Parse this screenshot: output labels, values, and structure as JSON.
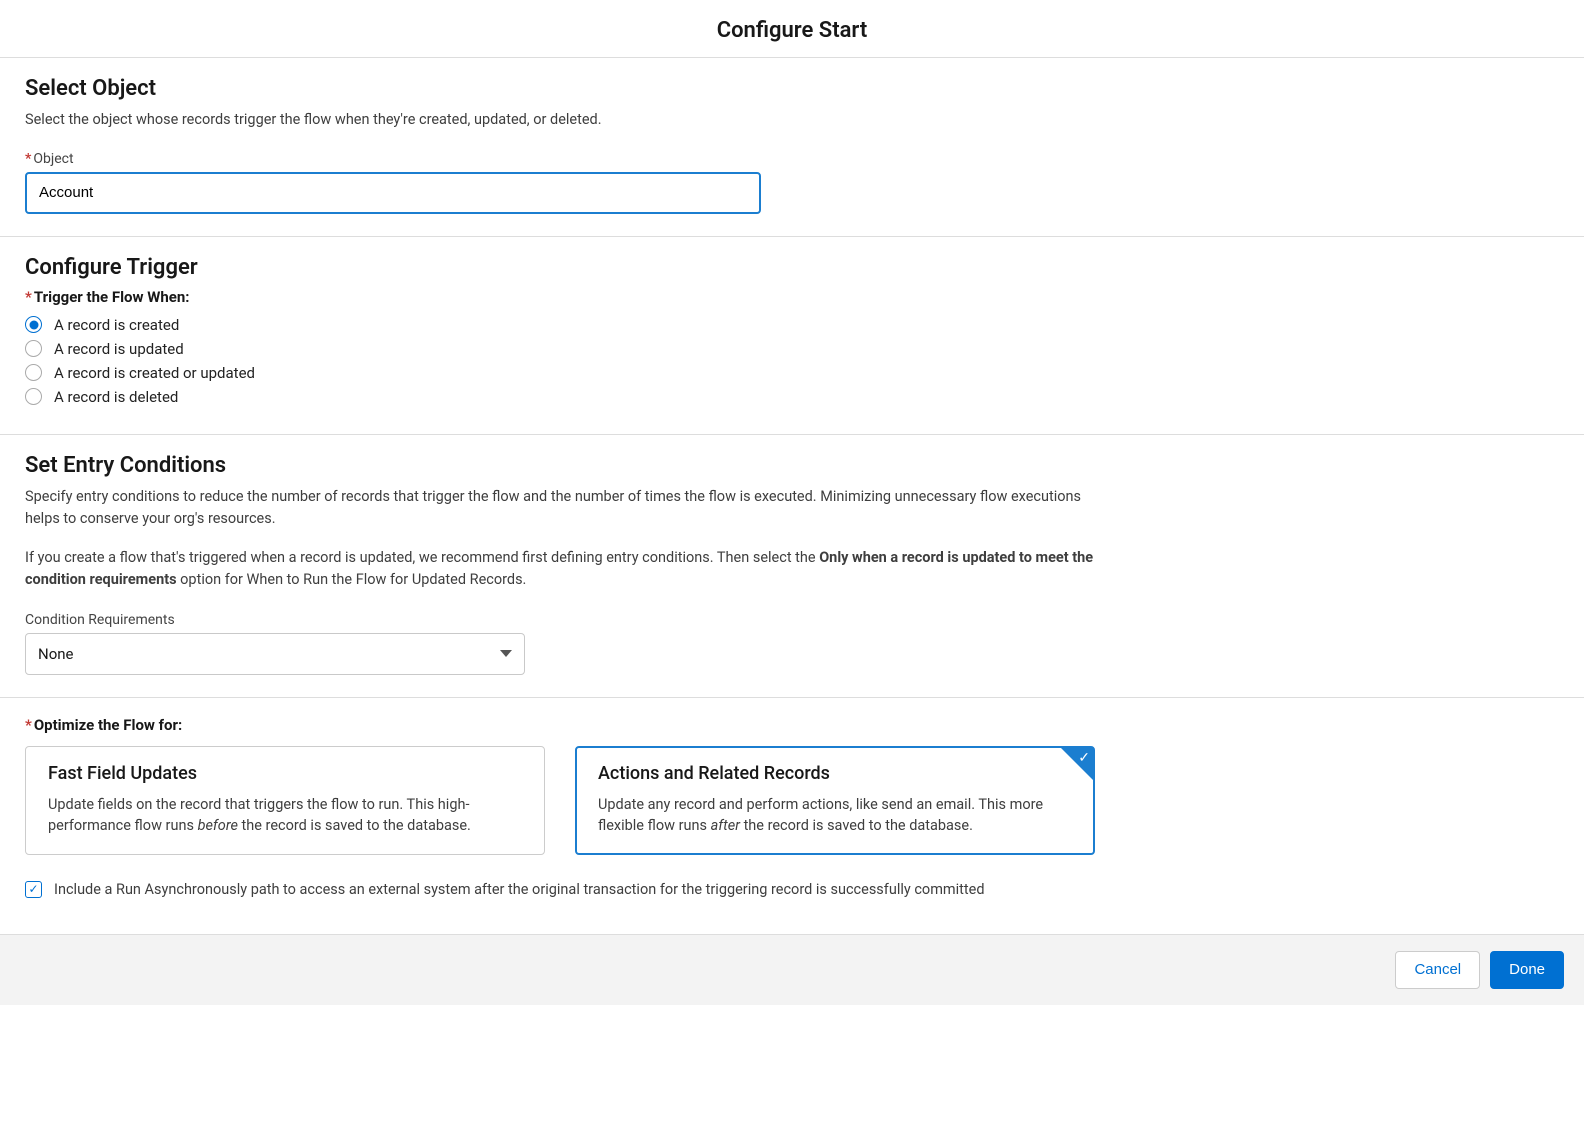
{
  "header": {
    "title": "Configure Start"
  },
  "selectObject": {
    "title": "Select Object",
    "description": "Select the object whose records trigger the flow when they're created, updated, or deleted.",
    "fieldLabel": "Object",
    "value": "Account"
  },
  "configureTrigger": {
    "title": "Configure Trigger",
    "label": "Trigger the Flow When:",
    "options": [
      {
        "label": "A record is created",
        "checked": true
      },
      {
        "label": "A record is updated",
        "checked": false
      },
      {
        "label": "A record is created or updated",
        "checked": false
      },
      {
        "label": "A record is deleted",
        "checked": false
      }
    ]
  },
  "entryConditions": {
    "title": "Set Entry Conditions",
    "desc1": "Specify entry conditions to reduce the number of records that trigger the flow and the number of times the flow is executed. Minimizing unnecessary flow executions helps to conserve your org's resources.",
    "desc2a": "If you create a flow that's triggered when a record is updated, we recommend first defining entry conditions. Then select the ",
    "desc2b": "Only when a record is updated to meet the condition requirements",
    "desc2c": " option for When to Run the Flow for Updated Records.",
    "condLabel": "Condition Requirements",
    "condValue": "None"
  },
  "optimize": {
    "label": "Optimize the Flow for:",
    "cards": [
      {
        "title": "Fast Field Updates",
        "desc_a": "Update fields on the record that triggers the flow to run. This high-performance flow runs ",
        "desc_b": "before",
        "desc_c": " the record is saved to the database.",
        "selected": false
      },
      {
        "title": "Actions and Related Records",
        "desc_a": "Update any record and perform actions, like send an email. This more flexible flow runs ",
        "desc_b": "after",
        "desc_c": " the record is saved to the database.",
        "selected": true
      }
    ]
  },
  "asyncCheckbox": {
    "label": "Include a Run Asynchronously path to access an external system after the original transaction for the triggering record is successfully committed",
    "checked": true
  },
  "footer": {
    "cancel": "Cancel",
    "done": "Done"
  }
}
